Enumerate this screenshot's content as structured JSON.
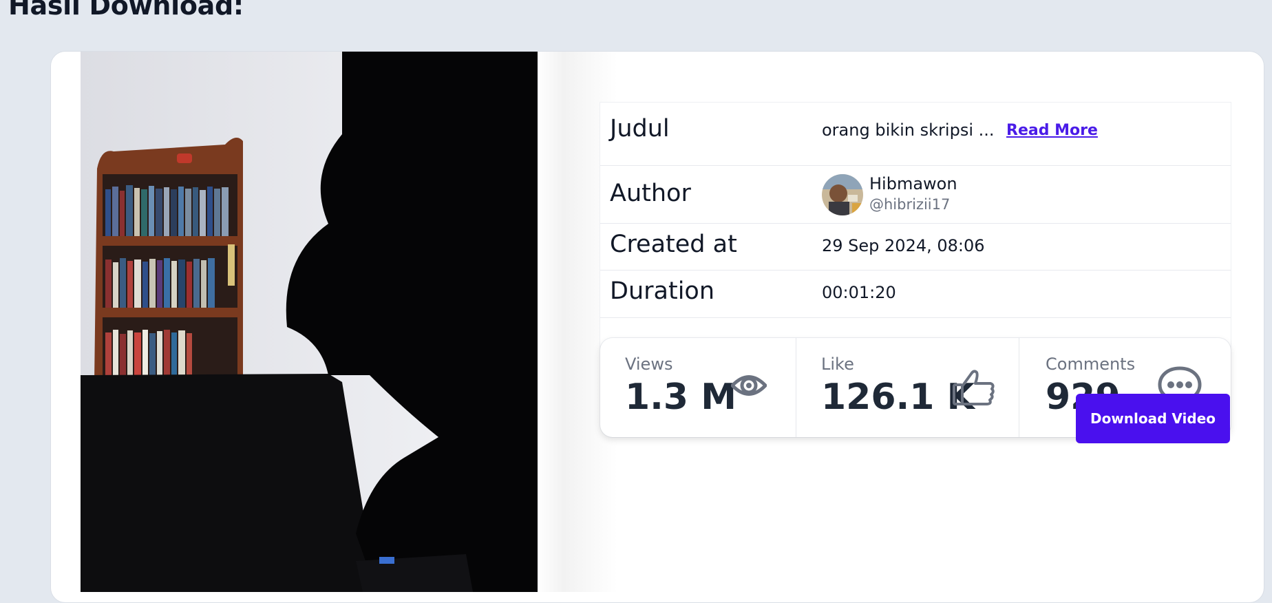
{
  "page": {
    "heading": "Hasil Download:"
  },
  "video": {
    "description": "video-thumbnail"
  },
  "info": {
    "rows": [
      {
        "label": "Judul",
        "value": "orang bikin skripsi ...",
        "link": "Read More"
      },
      {
        "label": "Author",
        "name": "Hibmawon",
        "handle": "@hibrizii17"
      },
      {
        "label": "Created at",
        "value": "29 Sep 2024, 08:06"
      },
      {
        "label": "Duration",
        "value": "00:01:20"
      }
    ]
  },
  "stats": [
    {
      "label": "Views",
      "value": "1.3 M",
      "icon": "eye-icon"
    },
    {
      "label": "Like",
      "value": "126.1 K",
      "icon": "thumbs-up-icon"
    },
    {
      "label": "Comments",
      "value": "929",
      "icon": "chat-bubble-icon"
    }
  ],
  "actions": {
    "download_label": "Download Video"
  },
  "colors": {
    "background": "#e3e8ef",
    "accent": "#4a10ee",
    "link": "#4a1ce8",
    "icon": "#6b7280"
  }
}
